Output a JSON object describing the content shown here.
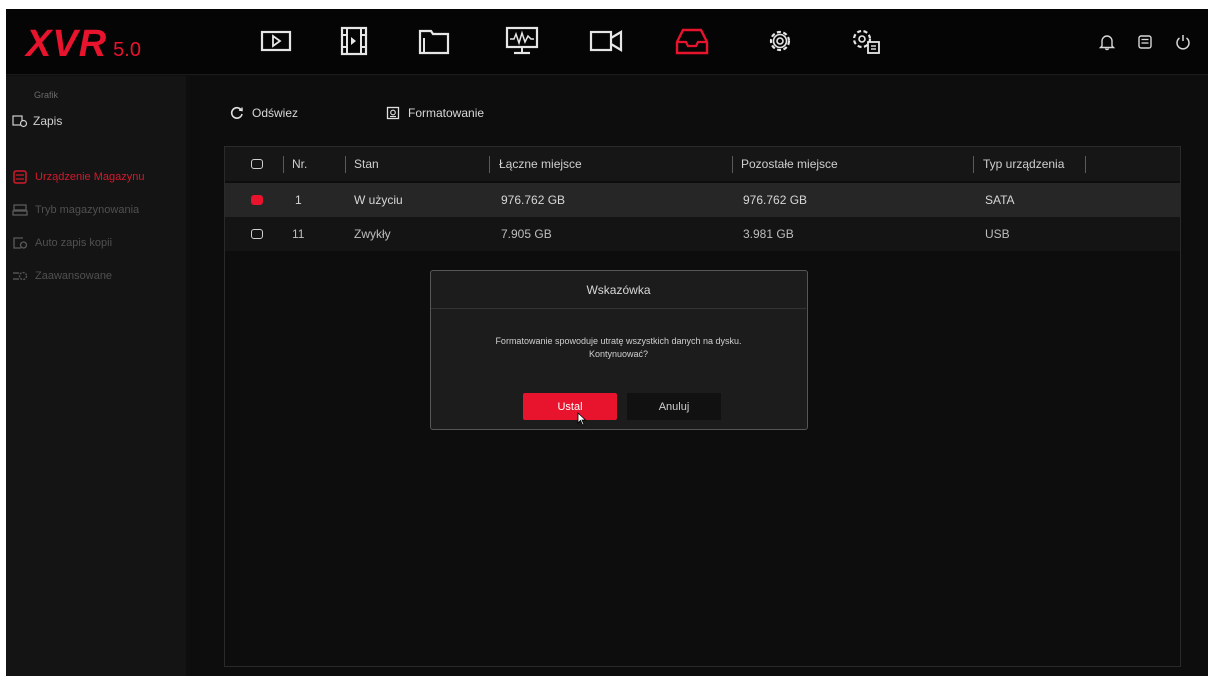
{
  "app": {
    "brand": "XVR",
    "version": "5.0"
  },
  "colors": {
    "accent": "#e8132d",
    "background": "#0d0d0d",
    "row_selected": "#262626"
  },
  "topnav": {
    "items": [
      {
        "icon": "playback-icon",
        "active": false
      },
      {
        "icon": "video-clip-icon",
        "active": false
      },
      {
        "icon": "file-folder-icon",
        "active": false
      },
      {
        "icon": "monitor-waveform-icon",
        "active": false
      },
      {
        "icon": "camera-icon",
        "active": false
      },
      {
        "icon": "storage-tray-icon",
        "active": true
      },
      {
        "icon": "settings-gear-icon",
        "active": false
      },
      {
        "icon": "system-gear-icon",
        "active": false
      }
    ],
    "right_icons": [
      "bell-icon",
      "device-icon",
      "power-icon"
    ]
  },
  "sidebar": {
    "heading": "Grafik",
    "group_label": "Zapis",
    "items": [
      {
        "label": "Urządzenie Magazynu",
        "icon": "storage-device-icon",
        "active": true
      },
      {
        "label": "Tryb magazynowania",
        "icon": "storage-mode-icon",
        "active": false
      },
      {
        "label": "Auto zapis kopii",
        "icon": "auto-backup-icon",
        "active": false
      },
      {
        "label": "Zaawansowane",
        "icon": "advanced-icon",
        "active": false
      }
    ]
  },
  "toolbar": {
    "refresh_label": "Odświez",
    "format_label": "Formatowanie"
  },
  "table": {
    "columns": [
      "Nr.",
      "Stan",
      "Łączne miejsce",
      "Pozostałe miejsce",
      "Typ urządzenia"
    ],
    "rows": [
      {
        "nr": "1",
        "stan": "W użyciu",
        "total": "976.762 GB",
        "remaining": "976.762 GB",
        "type": "SATA",
        "checked": true
      },
      {
        "nr": "11",
        "stan": "Zwykły",
        "total": "7.905 GB",
        "remaining": "3.981 GB",
        "type": "USB",
        "checked": false
      }
    ]
  },
  "dialog": {
    "title": "Wskazówka",
    "message_line1": "Formatowanie spowoduje utratę wszystkich danych na dysku.",
    "message_line2": "Kontynuować?",
    "ok_label": "Ustal",
    "cancel_label": "Anuluj"
  }
}
